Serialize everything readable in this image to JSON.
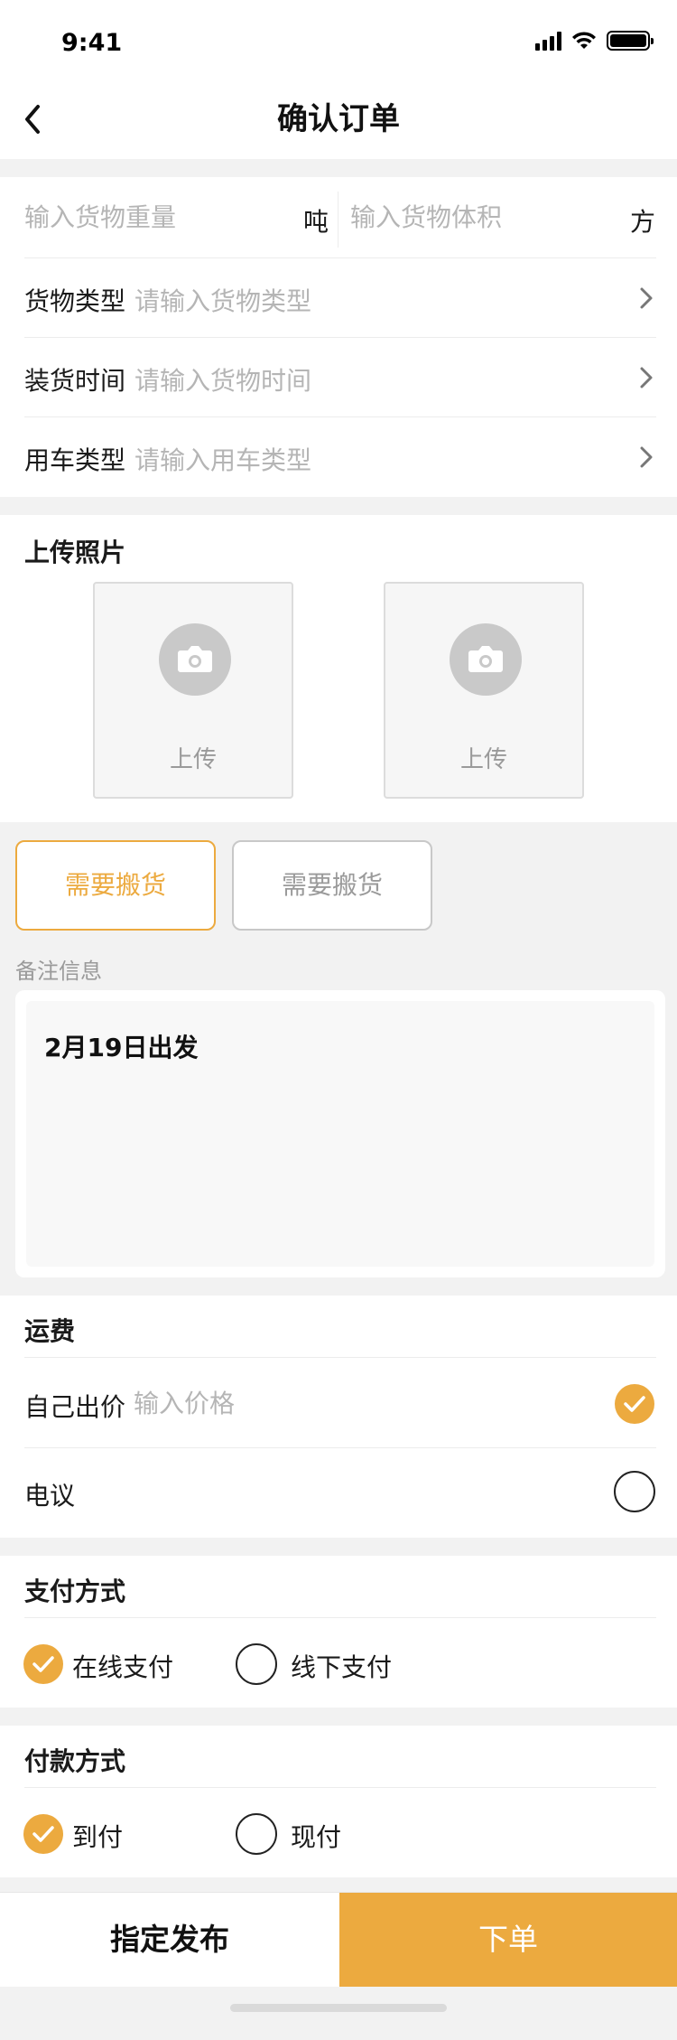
{
  "status_bar": {
    "time": "9:41"
  },
  "nav": {
    "title": "确认订单"
  },
  "cargo": {
    "weight_placeholder": "输入货物重量",
    "weight_unit": "吨",
    "volume_placeholder": "输入货物体积",
    "volume_unit": "方",
    "rows": [
      {
        "label": "货物类型",
        "placeholder": "请输入货物类型"
      },
      {
        "label": "装货时间",
        "placeholder": "请输入货物时间"
      },
      {
        "label": "用车类型",
        "placeholder": "请输入用车类型"
      }
    ]
  },
  "photos": {
    "title": "上传照片",
    "upload_label": "上传"
  },
  "options": {
    "buttons": [
      {
        "label": "需要搬货",
        "selected": true
      },
      {
        "label": "需要搬货",
        "selected": false
      }
    ]
  },
  "remark": {
    "label": "备注信息",
    "value": "2月19日出发"
  },
  "freight": {
    "title": "运费",
    "self_price_label": "自己出价",
    "price_placeholder": "输入价格",
    "self_price_selected": true,
    "negotiable_label": "电议",
    "negotiable_selected": false
  },
  "payment_method": {
    "title": "支付方式",
    "options": [
      {
        "label": "在线支付",
        "selected": true
      },
      {
        "label": "线下支付",
        "selected": false
      }
    ]
  },
  "payment_terms": {
    "title": "付款方式",
    "options": [
      {
        "label": "到付",
        "selected": true
      },
      {
        "label": "现付",
        "selected": false
      }
    ]
  },
  "bottom_bar": {
    "assign_label": "指定发布",
    "order_label": "下单"
  },
  "colors": {
    "accent": "#ecaa3f",
    "background": "#f2f2f2",
    "placeholder": "#b5b5b5"
  }
}
